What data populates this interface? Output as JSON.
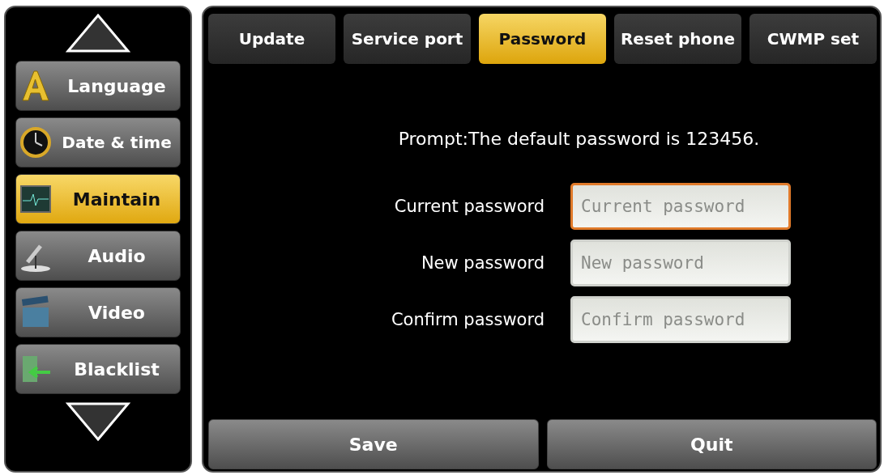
{
  "sidebar": {
    "items": [
      {
        "label": "Language",
        "selected": false
      },
      {
        "label": "Date & time",
        "selected": false
      },
      {
        "label": "Maintain",
        "selected": true
      },
      {
        "label": "Audio",
        "selected": false
      },
      {
        "label": "Video",
        "selected": false
      },
      {
        "label": "Blacklist",
        "selected": false
      }
    ]
  },
  "tabs": [
    {
      "label": "Update",
      "selected": false
    },
    {
      "label": "Service port",
      "selected": false
    },
    {
      "label": "Password",
      "selected": true
    },
    {
      "label": "Reset phone",
      "selected": false
    },
    {
      "label": "CWMP set",
      "selected": false
    }
  ],
  "prompt": "Prompt:The default password is 123456.",
  "fields": [
    {
      "label": "Current password",
      "placeholder": "Current password",
      "focused": true
    },
    {
      "label": "New password",
      "placeholder": "New password",
      "focused": false
    },
    {
      "label": "Confirm password",
      "placeholder": "Confirm password",
      "focused": false
    }
  ],
  "buttons": [
    "Save",
    "Quit"
  ]
}
